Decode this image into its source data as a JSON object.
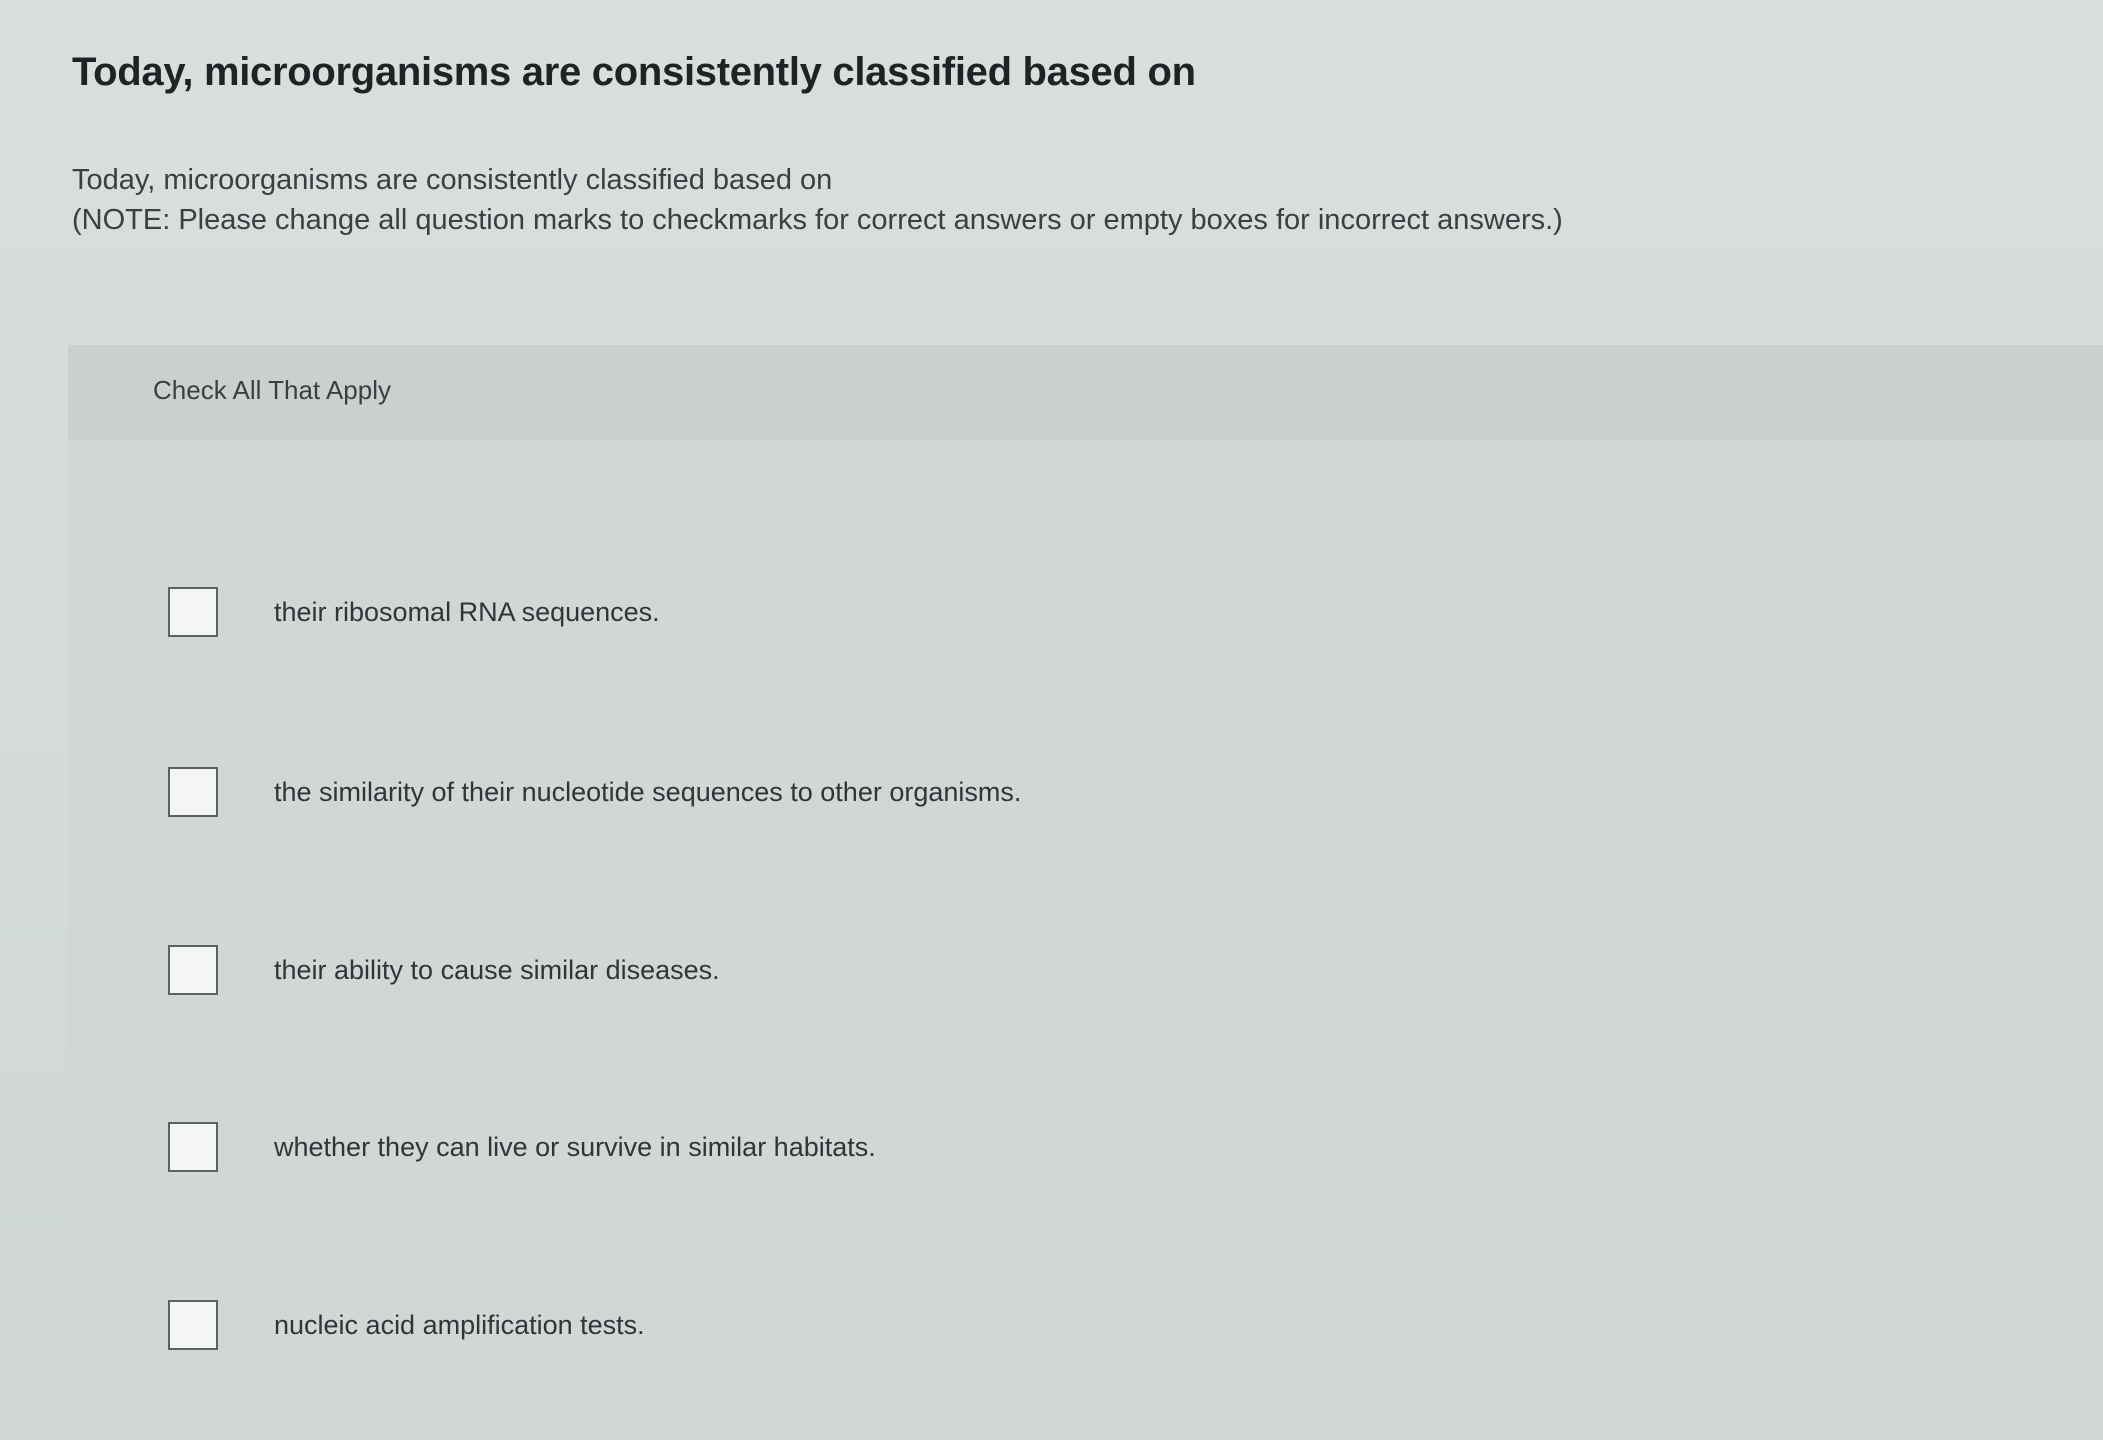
{
  "question": {
    "title": "Today, microorganisms are consistently classified based on",
    "prompt": "Today, microorganisms are consistently classified based on",
    "note": "(NOTE: Please change all question marks to checkmarks for correct answers or empty boxes for incorrect answers.)"
  },
  "answers": {
    "instruction": "Check All That Apply",
    "options": [
      {
        "label": "their ribosomal RNA sequences.",
        "checked": false
      },
      {
        "label": "the similarity of their nucleotide sequences to other organisms.",
        "checked": false
      },
      {
        "label": "their ability to cause similar diseases.",
        "checked": false
      },
      {
        "label": "whether they can live or survive in similar habitats.",
        "checked": false
      },
      {
        "label": "nucleic acid amplification tests.",
        "checked": false
      }
    ]
  }
}
